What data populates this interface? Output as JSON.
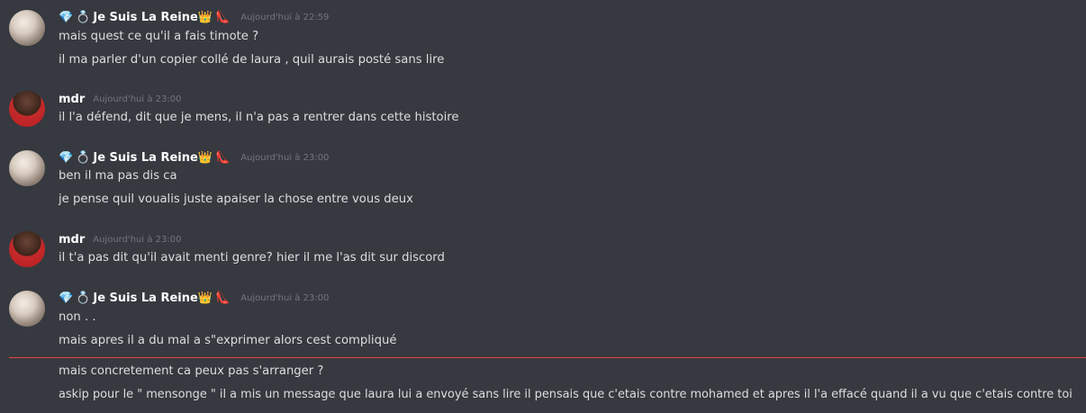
{
  "messages": [
    {
      "author": "Je Suis La Reine",
      "timestamp": "Aujourd'hui à 22:59",
      "lines": [
        "mais quest ce qu'il a fais timote ?",
        "il ma parler d'un copier collé de laura , quil aurais posté sans lire"
      ]
    },
    {
      "author": "mdr",
      "timestamp": "Aujourd'hui à 23:00",
      "lines": [
        "il l'a défend, dit que je mens, il n'a pas a rentrer dans cette histoire"
      ]
    },
    {
      "author": "Je Suis La Reine",
      "timestamp": "Aujourd'hui à 23:00",
      "lines": [
        "ben il ma pas dis ca",
        "je pense quil voualis juste apaiser la chose entre vous deux"
      ]
    },
    {
      "author": "mdr",
      "timestamp": "Aujourd'hui à 23:00",
      "lines": [
        "il t'a pas dit qu'il avait menti genre? hier il me l'as dit sur discord"
      ]
    },
    {
      "author": "Je Suis La Reine",
      "timestamp": "Aujourd'hui à 23:00",
      "lines": [
        "non . .",
        "mais apres il a du mal a s\"exprimer alors cest compliqué"
      ]
    }
  ],
  "new_messages": [
    "mais concretement ca peux pas s'arranger ?",
    "askip pour le \" mensonge \" il a mis un message que laura lui a envoyé sans lire il pensais que c'etais contre mohamed et apres il l'a effacé quand il a vu que c'etais contre toi"
  ],
  "icons": {
    "gem": "gem-emoji",
    "ring": "ring-emoji",
    "crown": "crown-emoji",
    "heel": "high-heel-emoji"
  },
  "colors": {
    "background": "#36393f",
    "divider": "#ed4245"
  }
}
